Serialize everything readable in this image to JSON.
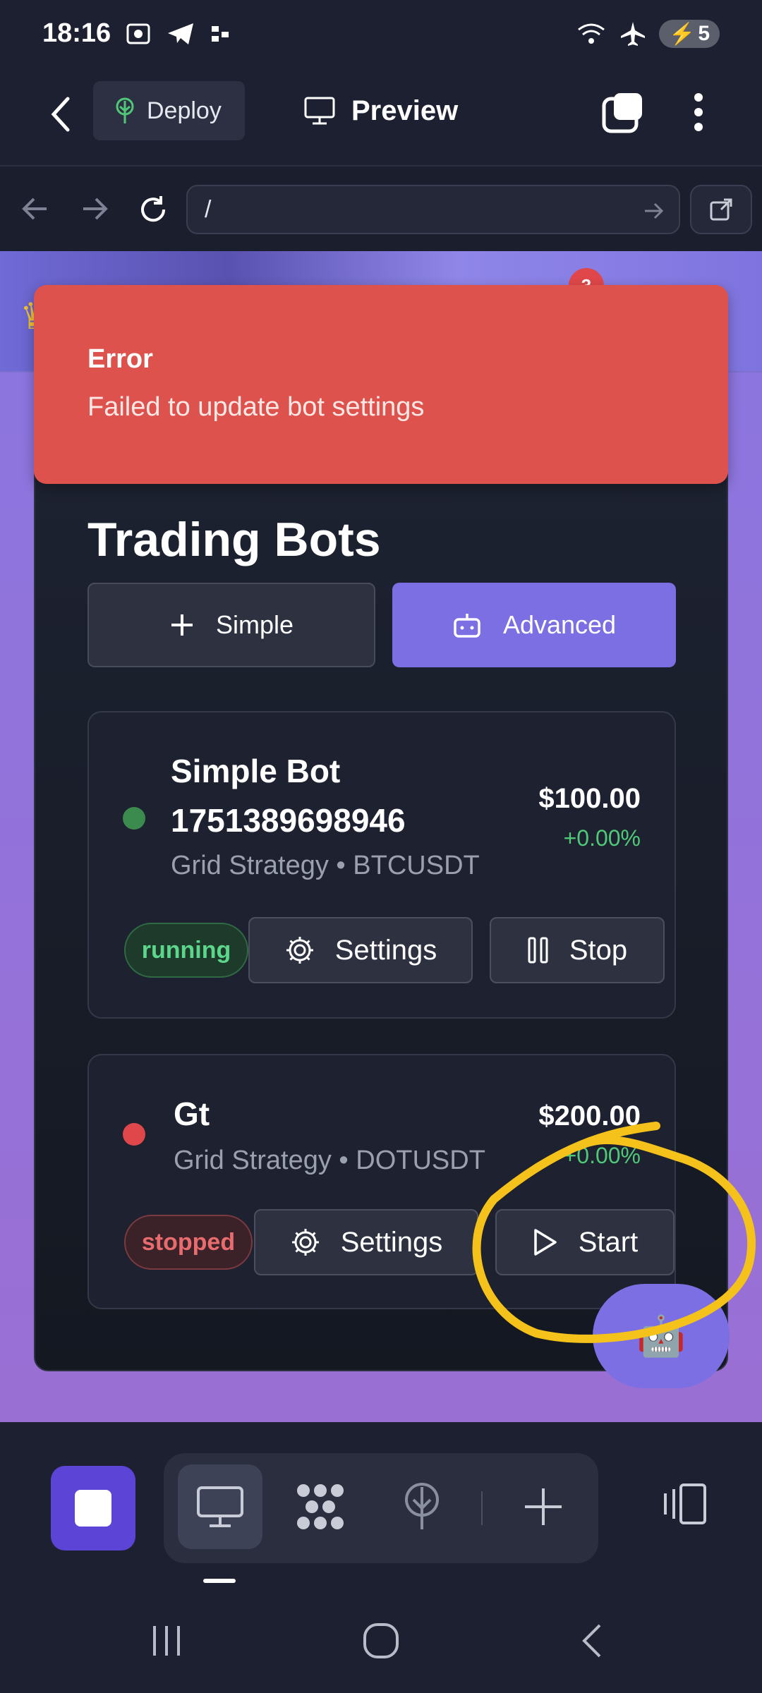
{
  "status_bar": {
    "time": "18:16",
    "battery": "5"
  },
  "app_bar": {
    "deploy_label": "Deploy",
    "preview_label": "Preview"
  },
  "url_bar": {
    "url": "/"
  },
  "web_header": {
    "notification_count": "3"
  },
  "toast": {
    "title": "Error",
    "message": "Failed to update bot settings"
  },
  "page": {
    "title": "Trading Bots",
    "simple_button": "Simple",
    "advanced_button": "Advanced"
  },
  "bots": [
    {
      "name": "Simple Bot 1751389698946",
      "strategy": "Grid Strategy • BTCUSDT",
      "value": "$100.00",
      "change": "+0.00%",
      "status": "running",
      "settings_label": "Settings",
      "action_label": "Stop"
    },
    {
      "name": "Gt",
      "strategy": "Grid Strategy • DOTUSDT",
      "value": "$200.00",
      "change": "+0.00%",
      "status": "stopped",
      "settings_label": "Settings",
      "action_label": "Start"
    }
  ],
  "colors": {
    "accent": "#7b6fe3",
    "error": "#dd524c",
    "running": "#5bd68a",
    "stopped": "#e86b6e",
    "annotation": "#f4c21a"
  },
  "icons": {
    "fab": "robot-icon",
    "back": "chevron-left-icon",
    "deploy": "tree-icon",
    "preview": "monitor-icon"
  }
}
